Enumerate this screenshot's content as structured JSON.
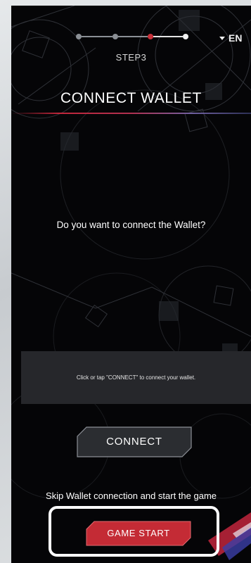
{
  "header": {
    "steps": [
      "step-1",
      "step-2",
      "step-3",
      "step-4"
    ],
    "current_step": 3,
    "step_label": "STEP3",
    "language": "EN"
  },
  "main": {
    "title": "CONNECT WALLET",
    "question": "Do you want to connect the Wallet?",
    "info_text": "Click or tap \"CONNECT\" to connect your wallet.",
    "connect_label": "CONNECT",
    "skip_text": "Skip Wallet connection and start the game",
    "start_label": "GAME START"
  },
  "colors": {
    "panel_bg": "#050507",
    "accent_red": "#c8313a",
    "info_box_bg": "#26272b",
    "connect_button_bg": "#2b2d31",
    "start_button_bg": "#c42b35",
    "highlight_border": "#ffffff"
  },
  "icons": {
    "language_caret": "caret-down-icon"
  }
}
